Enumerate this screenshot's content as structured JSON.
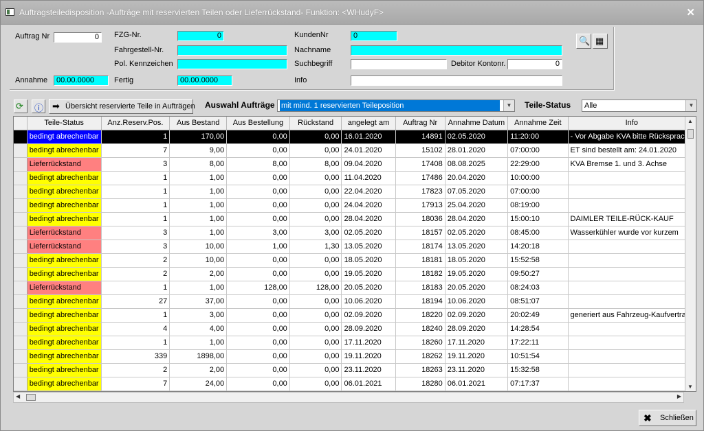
{
  "window": {
    "title": "Auftragsteiledisposition -Aufträge mit reservierten Teilen oder Lieferrückstand- Funktion: <WHudyF>"
  },
  "form": {
    "auftrag_nr_label": "Auftrag Nr",
    "auftrag_nr_value": "0",
    "annahme_label": "Annahme",
    "annahme_value": "00.00.0000",
    "fzg_nr_label": "FZG-Nr.",
    "fzg_nr_value": "0",
    "fahrgestell_label": "Fahrgestell-Nr.",
    "fahrgestell_value": "",
    "kennzeichen_label": "Pol. Kennzeichen",
    "kennzeichen_value": "",
    "fertig_label": "Fertig",
    "fertig_value": "00.00.0000",
    "kundennr_label": "KundenNr",
    "kundennr_value": "0",
    "nachname_label": "Nachname",
    "nachname_value": "",
    "suchbegriff_label": "Suchbegriff",
    "suchbegriff_value": "",
    "debitor_label": "Debitor Kontonr.",
    "debitor_value": "0",
    "info_label": "Info",
    "info_value": ""
  },
  "toolbar": {
    "overview_button": "Übersicht reservierte Teile in Aufträgen",
    "auswahl_label": "Auswahl Aufträge",
    "auswahl_value": "mit mind. 1 reservierten Teileposition",
    "teile_status_label": "Teile-Status",
    "teile_status_value": "Alle"
  },
  "table": {
    "columns": [
      "Teile-Status",
      "Anz.Reserv.Pos.",
      "Aus Bestand",
      "Aus Bestellung",
      "Rückstand",
      "angelegt am",
      "Auftrag Nr",
      "Annahme Datum",
      "Annahme Zeit",
      "Info"
    ],
    "rows": [
      {
        "status": "bedingt abrechenbar",
        "status_color": "blue",
        "anz": "1",
        "bestand": "170,00",
        "bestellung": "0,00",
        "rueckstand": "0,00",
        "angelegt": "16.01.2020",
        "auftrag": "14891",
        "datum": "02.05.2020",
        "zeit": "11:20:00",
        "info": "- Vor Abgabe KVA bitte Rücksprache"
      },
      {
        "status": "bedingt abrechenbar",
        "status_color": "yellow",
        "anz": "7",
        "bestand": "9,00",
        "bestellung": "0,00",
        "rueckstand": "0,00",
        "angelegt": "24.01.2020",
        "auftrag": "15102",
        "datum": "28.01.2020",
        "zeit": "07:00:00",
        "info": "ET sind bestellt am: 24.01.2020"
      },
      {
        "status": "Lieferrückstand",
        "status_color": "red",
        "anz": "3",
        "bestand": "8,00",
        "bestellung": "8,00",
        "rueckstand": "8,00",
        "angelegt": "09.04.2020",
        "auftrag": "17408",
        "datum": "08.08.2025",
        "zeit": "22:29:00",
        "info": "KVA   Bremse 1. und 3. Achse"
      },
      {
        "status": "bedingt abrechenbar",
        "status_color": "yellow",
        "anz": "1",
        "bestand": "1,00",
        "bestellung": "0,00",
        "rueckstand": "0,00",
        "angelegt": "11.04.2020",
        "auftrag": "17486",
        "datum": "20.04.2020",
        "zeit": "10:00:00",
        "info": ""
      },
      {
        "status": "bedingt abrechenbar",
        "status_color": "yellow",
        "anz": "1",
        "bestand": "1,00",
        "bestellung": "0,00",
        "rueckstand": "0,00",
        "angelegt": "22.04.2020",
        "auftrag": "17823",
        "datum": "07.05.2020",
        "zeit": "07:00:00",
        "info": ""
      },
      {
        "status": "bedingt abrechenbar",
        "status_color": "yellow",
        "anz": "1",
        "bestand": "1,00",
        "bestellung": "0,00",
        "rueckstand": "0,00",
        "angelegt": "24.04.2020",
        "auftrag": "17913",
        "datum": "25.04.2020",
        "zeit": "08:19:00",
        "info": ""
      },
      {
        "status": "bedingt abrechenbar",
        "status_color": "yellow",
        "anz": "1",
        "bestand": "1,00",
        "bestellung": "0,00",
        "rueckstand": "0,00",
        "angelegt": "28.04.2020",
        "auftrag": "18036",
        "datum": "28.04.2020",
        "zeit": "15:00:10",
        "info": "DAIMLER TEILE-RÜCK-KAUF"
      },
      {
        "status": "Lieferrückstand",
        "status_color": "red",
        "anz": "3",
        "bestand": "1,00",
        "bestellung": "3,00",
        "rueckstand": "3,00",
        "angelegt": "02.05.2020",
        "auftrag": "18157",
        "datum": "02.05.2020",
        "zeit": "08:45:00",
        "info": "Wasserkühler wurde vor kurzem"
      },
      {
        "status": "Lieferrückstand",
        "status_color": "red",
        "anz": "3",
        "bestand": "10,00",
        "bestellung": "1,00",
        "rueckstand": "1,30",
        "angelegt": "13.05.2020",
        "auftrag": "18174",
        "datum": "13.05.2020",
        "zeit": "14:20:18",
        "info": ""
      },
      {
        "status": "bedingt abrechenbar",
        "status_color": "yellow",
        "anz": "2",
        "bestand": "10,00",
        "bestellung": "0,00",
        "rueckstand": "0,00",
        "angelegt": "18.05.2020",
        "auftrag": "18181",
        "datum": "18.05.2020",
        "zeit": "15:52:58",
        "info": ""
      },
      {
        "status": "bedingt abrechenbar",
        "status_color": "yellow",
        "anz": "2",
        "bestand": "2,00",
        "bestellung": "0,00",
        "rueckstand": "0,00",
        "angelegt": "19.05.2020",
        "auftrag": "18182",
        "datum": "19.05.2020",
        "zeit": "09:50:27",
        "info": ""
      },
      {
        "status": "Lieferrückstand",
        "status_color": "red",
        "anz": "1",
        "bestand": "1,00",
        "bestellung": "128,00",
        "rueckstand": "128,00",
        "angelegt": "20.05.2020",
        "auftrag": "18183",
        "datum": "20.05.2020",
        "zeit": "08:24:03",
        "info": ""
      },
      {
        "status": "bedingt abrechenbar",
        "status_color": "yellow",
        "anz": "27",
        "bestand": "37,00",
        "bestellung": "0,00",
        "rueckstand": "0,00",
        "angelegt": "10.06.2020",
        "auftrag": "18194",
        "datum": "10.06.2020",
        "zeit": "08:51:07",
        "info": ""
      },
      {
        "status": "bedingt abrechenbar",
        "status_color": "yellow",
        "anz": "1",
        "bestand": "3,00",
        "bestellung": "0,00",
        "rueckstand": "0,00",
        "angelegt": "02.09.2020",
        "auftrag": "18220",
        "datum": "02.09.2020",
        "zeit": "20:02:49",
        "info": "generiert aus Fahrzeug-Kaufvertrag"
      },
      {
        "status": "bedingt abrechenbar",
        "status_color": "yellow",
        "anz": "4",
        "bestand": "4,00",
        "bestellung": "0,00",
        "rueckstand": "0,00",
        "angelegt": "28.09.2020",
        "auftrag": "18240",
        "datum": "28.09.2020",
        "zeit": "14:28:54",
        "info": ""
      },
      {
        "status": "bedingt abrechenbar",
        "status_color": "yellow",
        "anz": "1",
        "bestand": "1,00",
        "bestellung": "0,00",
        "rueckstand": "0,00",
        "angelegt": "17.11.2020",
        "auftrag": "18260",
        "datum": "17.11.2020",
        "zeit": "17:22:11",
        "info": ""
      },
      {
        "status": "bedingt abrechenbar",
        "status_color": "yellow",
        "anz": "339",
        "bestand": "1898,00",
        "bestellung": "0,00",
        "rueckstand": "0,00",
        "angelegt": "19.11.2020",
        "auftrag": "18262",
        "datum": "19.11.2020",
        "zeit": "10:51:54",
        "info": ""
      },
      {
        "status": "bedingt abrechenbar",
        "status_color": "yellow",
        "anz": "2",
        "bestand": "2,00",
        "bestellung": "0,00",
        "rueckstand": "0,00",
        "angelegt": "23.11.2020",
        "auftrag": "18263",
        "datum": "23.11.2020",
        "zeit": "15:32:58",
        "info": ""
      },
      {
        "status": "bedingt abrechenbar",
        "status_color": "yellow",
        "anz": "7",
        "bestand": "24,00",
        "bestellung": "0,00",
        "rueckstand": "0,00",
        "angelegt": "06.01.2021",
        "auftrag": "18280",
        "datum": "06.01.2021",
        "zeit": "07:17:37",
        "info": ""
      }
    ]
  },
  "footer": {
    "close_button": "Schließen"
  },
  "colors": {
    "cyan_field": "#00ffff",
    "status_blue": "#0000ff",
    "status_yellow": "#ffff00",
    "status_red": "#ff8080"
  },
  "icons": [
    "window-icon",
    "close-icon",
    "search-print-icon",
    "export-icon",
    "refresh-icon",
    "info-icon",
    "arrow-right-icon",
    "dropdown-arrow-icon",
    "close-x-icon"
  ]
}
